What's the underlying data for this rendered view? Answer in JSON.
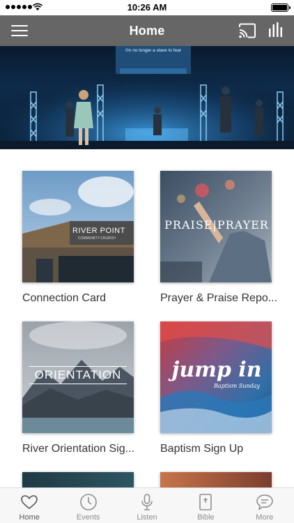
{
  "status_bar": {
    "time": "10:26 AM"
  },
  "nav": {
    "title": "Home"
  },
  "hero": {
    "screen_text": "I'm no longer a slave to fear"
  },
  "tiles": [
    {
      "label": "Connection Card",
      "sign_text": "RIVER POINT",
      "sign_sub": "COMMUNITY CHURCH"
    },
    {
      "label": "Prayer & Praise Repo...",
      "overlay_text": "PRAISE|PRAYER"
    },
    {
      "label": "River Orientation Sig...",
      "overlay_text": "ORIENTATION"
    },
    {
      "label": "Baptism Sign Up",
      "overlay_text": "jump in",
      "overlay_sub": "Baptism Sunday"
    }
  ],
  "tabs": [
    {
      "label": "Home",
      "icon": "heart-icon"
    },
    {
      "label": "Events",
      "icon": "clock-icon"
    },
    {
      "label": "Listen",
      "icon": "microphone-icon"
    },
    {
      "label": "Bible",
      "icon": "book-icon"
    },
    {
      "label": "More",
      "icon": "chat-bubble-icon"
    }
  ],
  "colors": {
    "nav_bg": "#666666",
    "tab_active": "#555555",
    "tab_inactive": "#8e8e8e"
  }
}
